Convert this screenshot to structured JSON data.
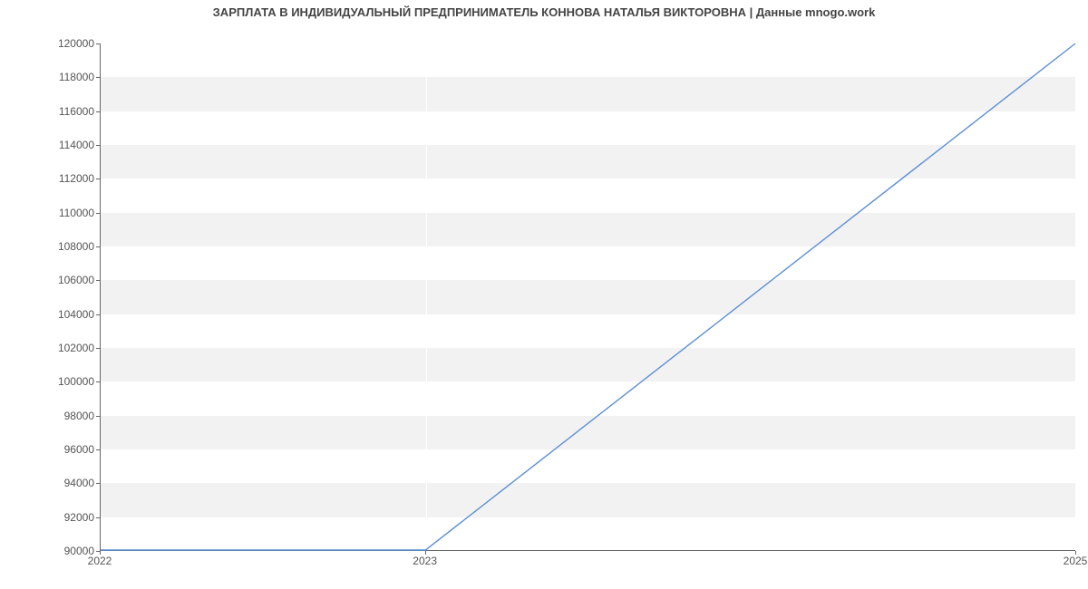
{
  "chart_data": {
    "type": "line",
    "title": "ЗАРПЛАТА В ИНДИВИДУАЛЬНЫЙ ПРЕДПРИНИМАТЕЛЬ КОННОВА НАТАЛЬЯ ВИКТОРОВНА | Данные mnogo.work",
    "x": [
      2022,
      2023,
      2025
    ],
    "values": [
      90000,
      90000,
      120000
    ],
    "x_ticks": [
      2022,
      2023,
      2025
    ],
    "y_ticks": [
      90000,
      92000,
      94000,
      96000,
      98000,
      100000,
      102000,
      104000,
      106000,
      108000,
      110000,
      112000,
      114000,
      116000,
      118000,
      120000
    ],
    "xlim": [
      2022,
      2025
    ],
    "ylim": [
      90000,
      120000
    ],
    "xlabel": "",
    "ylabel": "",
    "line_color": "#5b8fd6",
    "grid": true
  }
}
